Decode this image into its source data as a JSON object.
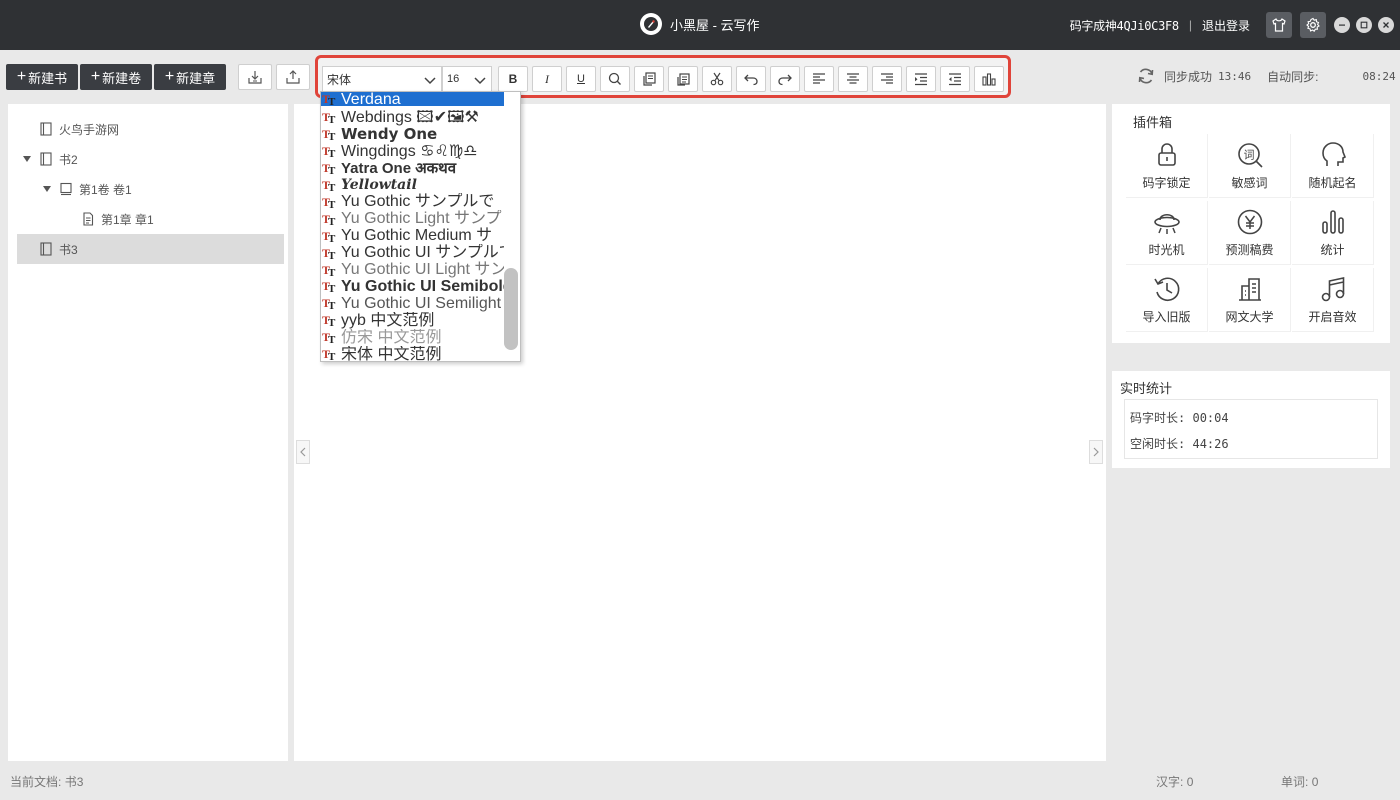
{
  "app": {
    "title": "小黑屋 - 云写作",
    "username": "码字成神4QJi0C3F8",
    "separator": "|",
    "logout": "退出登录"
  },
  "toolbar": {
    "new_book": "新建书",
    "new_volume": "新建卷",
    "new_chapter": "新建章",
    "font_value": "宋体",
    "size_value": "16",
    "bold": "B",
    "italic": "I",
    "underline": "U"
  },
  "sync": {
    "status": "同步成功",
    "time": "13:46",
    "auto_label": "自动同步:",
    "auto_time": "08:24"
  },
  "tree": {
    "items": [
      {
        "label": "火鸟手游网"
      },
      {
        "label": "书2"
      },
      {
        "label": "第1卷 卷1"
      },
      {
        "label": "第1章 章1"
      },
      {
        "label": "书3"
      }
    ]
  },
  "font_dropdown": {
    "options": [
      {
        "label": "Verdana"
      },
      {
        "label": "Webdings 🖾✔🖼⚒"
      },
      {
        "label": "Wendy One"
      },
      {
        "label": "Wingdings ♋♌♍♎"
      },
      {
        "label": "Yatra One अकथव"
      },
      {
        "label": "Yellowtail"
      },
      {
        "label": "Yu Gothic サンプルで"
      },
      {
        "label": "Yu Gothic Light サンプ"
      },
      {
        "label": "Yu Gothic Medium サ"
      },
      {
        "label": "Yu Gothic UI サンプルで"
      },
      {
        "label": "Yu Gothic UI Light サン"
      },
      {
        "label": "Yu Gothic UI Semibold"
      },
      {
        "label": "Yu Gothic UI Semilight"
      },
      {
        "label": "yyb 中文范例"
      },
      {
        "label": "仿宋 中文范例"
      },
      {
        "label": "宋体 中文范例"
      }
    ]
  },
  "plugins": {
    "title": "插件箱",
    "items": [
      {
        "label": "码字锁定",
        "icon": "lock-icon"
      },
      {
        "label": "敏感词",
        "icon": "sensitive-word-icon"
      },
      {
        "label": "随机起名",
        "icon": "head-icon"
      },
      {
        "label": "时光机",
        "icon": "ufo-icon"
      },
      {
        "label": "预测稿费",
        "icon": "yen-icon"
      },
      {
        "label": "统计",
        "icon": "bar-chart-icon"
      },
      {
        "label": "导入旧版",
        "icon": "history-icon"
      },
      {
        "label": "网文大学",
        "icon": "building-icon"
      },
      {
        "label": "开启音效",
        "icon": "music-icon"
      }
    ]
  },
  "stats": {
    "title": "实时统计",
    "typing_label": "码字时长:",
    "typing_value": "00:04",
    "idle_label": "空闲时长:",
    "idle_value": "44:26"
  },
  "status": {
    "current_doc_label": "当前文档:",
    "current_doc": "书3",
    "hanzi_label": "汉字:",
    "hanzi": "0",
    "words_label": "单词:",
    "words": "0"
  },
  "colors": {
    "titlebar": "#2f3134",
    "highlight_box": "#e0443a",
    "dropdown_selected": "#1e6fd0"
  }
}
